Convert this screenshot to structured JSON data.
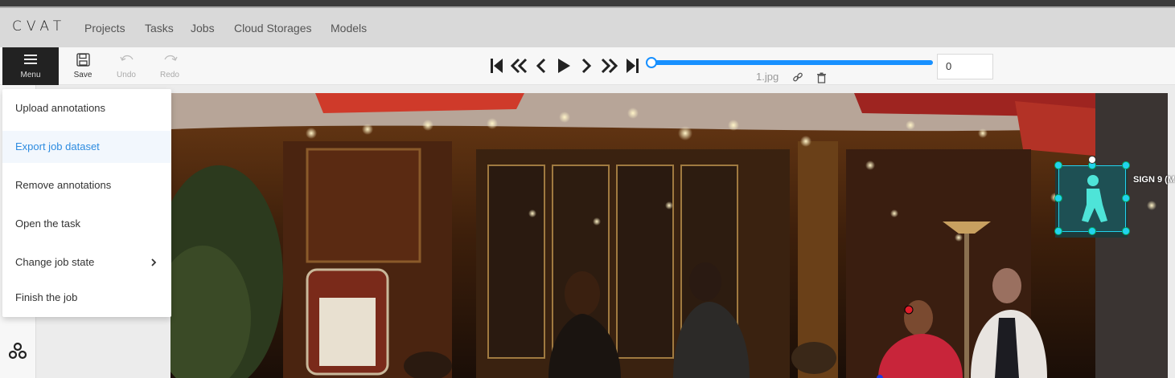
{
  "app": {
    "logo": "CVAT"
  },
  "nav": {
    "items": [
      "Projects",
      "Tasks",
      "Jobs",
      "Cloud Storages",
      "Models"
    ]
  },
  "toolbar": {
    "menu_label": "Menu",
    "save_label": "Save",
    "undo_label": "Undo",
    "redo_label": "Redo"
  },
  "player": {
    "frame_value": "0",
    "filename": "1.jpg",
    "progress": 0
  },
  "menu": {
    "items": [
      "Upload annotations",
      "Export job dataset",
      "Remove annotations",
      "Open the task",
      "Change job state",
      "Finish the job"
    ],
    "active_index": 1
  },
  "annotation": {
    "label": "SIGN 9 (M"
  },
  "colors": {
    "accent": "#1890ff",
    "bbox": "#22d3ee",
    "menu_bg": "#222222"
  }
}
